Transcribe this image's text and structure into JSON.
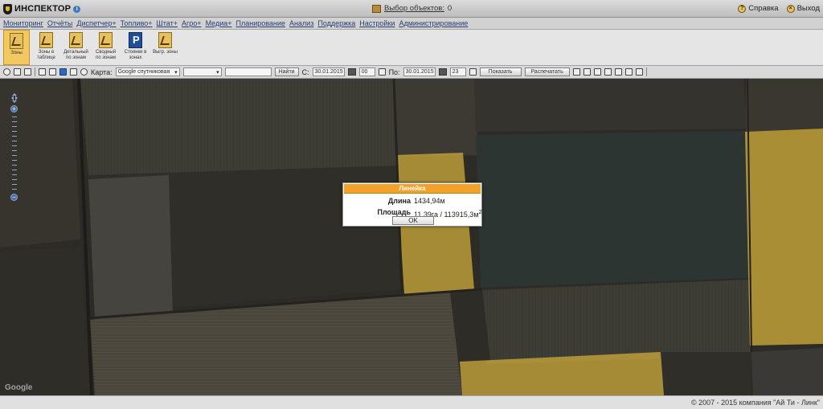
{
  "titlebar": {
    "app_name": "ИНСПЕКТОР",
    "object_select_label": "Выбор объектов:",
    "object_select_count": "0",
    "help_label": "Справка",
    "exit_label": "Выход"
  },
  "menu": {
    "items": [
      "Мониторинг",
      "Отчёты",
      "Диспетчер+",
      "Топливо+",
      "Штат+",
      "Агро+",
      "Медиа+",
      "Планирование",
      "Анализ",
      "Поддержка",
      "Настройки",
      "Администрирование"
    ]
  },
  "ribbon": {
    "buttons": [
      {
        "label": "Зоны",
        "icon": "zone-icon"
      },
      {
        "label": "Зоны в таблице",
        "icon": "zone-table-icon"
      },
      {
        "label": "Детальный по зонам",
        "icon": "zone-detail-icon"
      },
      {
        "label": "Сводный по зонам",
        "icon": "zone-summary-icon"
      },
      {
        "label": "Стоянки в зонах",
        "icon": "parking-icon"
      },
      {
        "label": "Выгр. зоны",
        "icon": "zone-export-icon"
      }
    ]
  },
  "toolbar": {
    "map_label": "Карта:",
    "map_type": "Google спутниковая",
    "search_button": "Найти",
    "from_label": "С:",
    "from_date": "30.01.2015",
    "from_hour": "00",
    "to_label": "По:",
    "to_date": "30.01.2015",
    "to_hour": "23",
    "show_button": "Показать",
    "print_button": "Распечатать"
  },
  "dialog": {
    "title": "Линейка",
    "length_label": "Длина",
    "length_value": "1434,94м",
    "area_label": "Площадь",
    "area_value": "11,39га / 113915,3м",
    "area_sup": "2",
    "ok_label": "OK"
  },
  "map": {
    "google_label": "Google"
  },
  "footer": {
    "copyright": "© 2007 - 2015 компания \"Ай Ти - Линк\""
  }
}
